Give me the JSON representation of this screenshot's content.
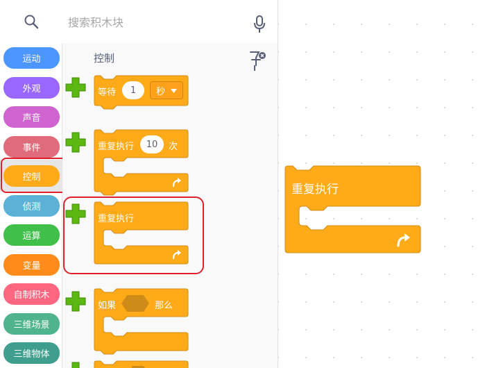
{
  "categories": [
    {
      "label": "运动",
      "color": "#4c97ff",
      "name": "category-motion"
    },
    {
      "label": "外观",
      "color": "#9966ff",
      "name": "category-looks"
    },
    {
      "label": "声音",
      "color": "#cf63cf",
      "name": "category-sound"
    },
    {
      "label": "事件",
      "color": "#e06b7a",
      "name": "category-events"
    },
    {
      "label": "控制",
      "color": "#ffab19",
      "name": "category-control"
    },
    {
      "label": "侦测",
      "color": "#5cb1d6",
      "name": "category-sensing"
    },
    {
      "label": "运算",
      "color": "#40bf4a",
      "name": "category-operators"
    },
    {
      "label": "变量",
      "color": "#ff8c1a",
      "name": "category-variables"
    },
    {
      "label": "自制积木",
      "color": "#ff6680",
      "name": "category-my-blocks"
    },
    {
      "label": "三维场景",
      "color": "#4fb48d",
      "name": "category-3d-scene"
    },
    {
      "label": "三维物体",
      "color": "#3f9e8d",
      "name": "category-3d-object"
    }
  ],
  "active_category": "控制",
  "search": {
    "placeholder": "搜索积木块"
  },
  "palette": {
    "section_title": "控制",
    "wait_block": {
      "label": "等待",
      "value": "1",
      "unit": "秒"
    },
    "repeat_block": {
      "label": "重复执行",
      "value": "10",
      "suffix": "次"
    },
    "forever_block": {
      "label": "重复执行"
    },
    "if_block": {
      "label_if": "如果",
      "label_then": "那么"
    }
  },
  "canvas": {
    "forever_block": {
      "label": "重复执行"
    }
  },
  "colors": {
    "control": "#ffab19",
    "control_border": "#cf8b17",
    "highlight": "#e0202b",
    "plus_green": "#5cb712"
  }
}
